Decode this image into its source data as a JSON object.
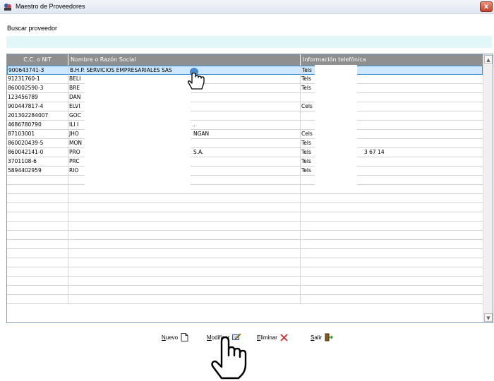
{
  "window": {
    "title": "Maestro de Proveedores",
    "close_label": "x"
  },
  "search": {
    "label": "Buscar proveedor",
    "value": "",
    "placeholder": ""
  },
  "grid": {
    "columns": [
      "C.C. o NIT",
      "Nombre o Razón Social",
      "Información telefónica"
    ],
    "rows": [
      {
        "nit": "900643741-3",
        "name": "B.H.P. SERVICIOS EMPRESARIALES SAS",
        "phone": "Tels",
        "selected": true
      },
      {
        "nit": "91231760-1",
        "name": "BELI",
        "phone": "Tels"
      },
      {
        "nit": "860002590-3",
        "name": "BRE",
        "phone": "Tels"
      },
      {
        "nit": "123456789",
        "name": "DAN",
        "phone": ""
      },
      {
        "nit": "900447817-4",
        "name": "ELVI",
        "phone": "Cels"
      },
      {
        "nit": "201302284007",
        "name": "GOC",
        "phone": ""
      },
      {
        "nit": "4686780790",
        "name": "ILI I",
        "name_tail": ".",
        "phone": ""
      },
      {
        "nit": "87103001",
        "name": "JHO",
        "name_tail": "NGAN",
        "phone": "Cels"
      },
      {
        "nit": "860020439-5",
        "name": "MON",
        "phone": "Tels"
      },
      {
        "nit": "860042141-0",
        "name": "PRO",
        "name_tail": "S.A.",
        "phone": "Tels",
        "phone_tail": "3 67 14"
      },
      {
        "nit": "3701108-6",
        "name": "PRC",
        "phone": "Tels"
      },
      {
        "nit": "5894402959",
        "name": "RIO",
        "phone": "Tels"
      }
    ],
    "empty_rows": 14
  },
  "toolbar": {
    "nuevo": {
      "accel": "N",
      "rest": "uevo",
      "icon": "new-document-icon"
    },
    "modificar": {
      "accel": "M",
      "rest": "odificar",
      "icon": "edit-icon"
    },
    "eliminar": {
      "accel": "E",
      "rest": "liminar",
      "icon": "delete-x-icon"
    },
    "salir": {
      "accel": "S",
      "rest": "alir",
      "icon": "exit-door-icon"
    }
  },
  "colors": {
    "header_bg": "#8f8f8f",
    "selection": "#cde8ff",
    "search_bg": "#e2f8f8",
    "delete_red": "#d62a2a"
  }
}
